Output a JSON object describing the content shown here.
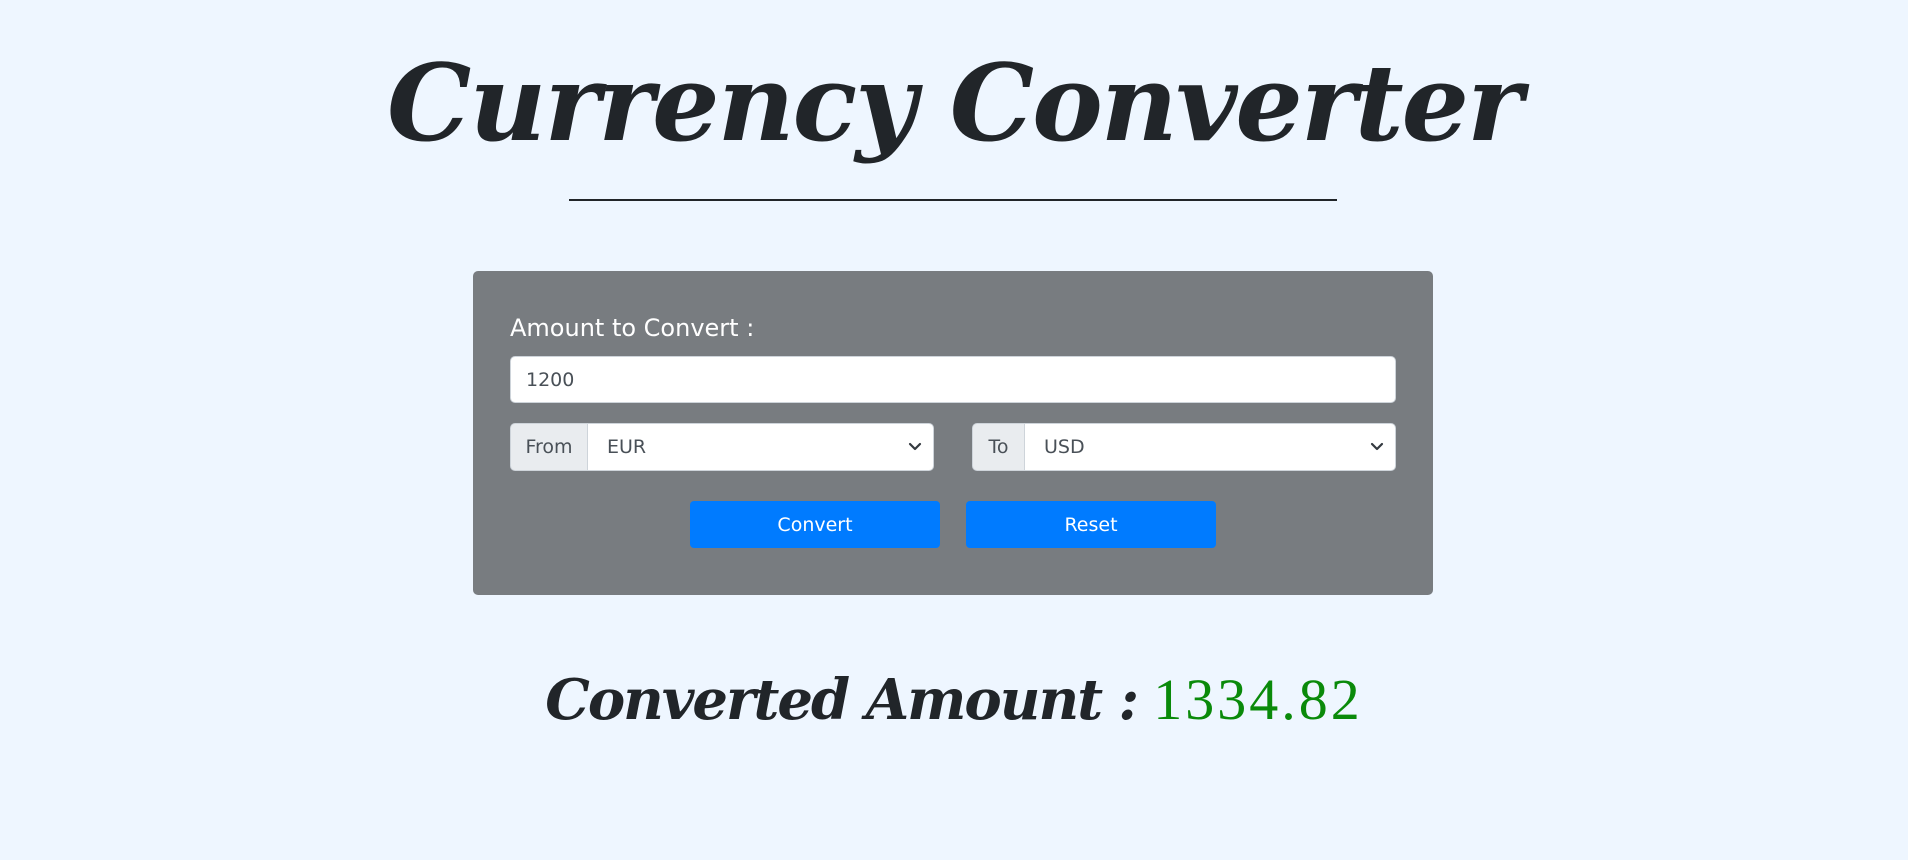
{
  "app": {
    "title": "Currency Converter"
  },
  "form": {
    "amount_label": "Amount to Convert :",
    "amount_value": "1200",
    "from_label": "From",
    "from_value": "EUR",
    "to_label": "To",
    "to_value": "USD",
    "convert_label": "Convert",
    "reset_label": "Reset"
  },
  "result": {
    "label": "Converted Amount :",
    "value": "1334.82"
  },
  "icons": {
    "from_select": "chevron-down-icon",
    "to_select": "chevron-down-icon"
  },
  "colors": {
    "background": "#eef6ff",
    "card": "#787c80",
    "button": "#007bff",
    "result_value": "#0a8a0a"
  }
}
